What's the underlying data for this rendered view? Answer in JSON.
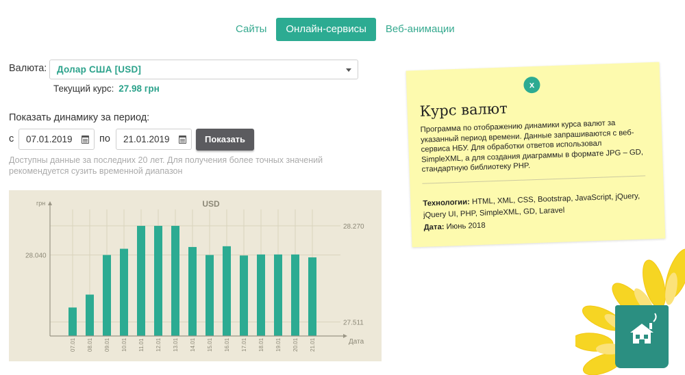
{
  "nav": {
    "tabs": [
      {
        "label": "Сайты",
        "active": false
      },
      {
        "label": "Онлайн-сервисы",
        "active": true
      },
      {
        "label": "Веб-анимации",
        "active": false
      }
    ]
  },
  "form": {
    "currency_label": "Валюта:",
    "currency_value": "Долар США [USD]",
    "rate_label": "Текущий курс:",
    "rate_value": "27.98 грн",
    "period_label": "Показать динамику за период:",
    "from_label": "с",
    "from_date": "07.01.2019",
    "to_label": "по",
    "to_date": "21.01.2019",
    "show_button": "Показать",
    "note": "Доступны данные за последних 20 лет. Для получения более точных значений рекомендуется сузить временной диапазон"
  },
  "chart_data": {
    "type": "bar",
    "title": "USD",
    "ylabel": "грн",
    "xlabel": "Дата",
    "categories": [
      "07.01",
      "08.01",
      "09.01",
      "10.01",
      "11.01",
      "12.01",
      "13.01",
      "14.01",
      "15.01",
      "16.01",
      "17.01",
      "18.01",
      "19.01",
      "20.01",
      "21.01"
    ],
    "values": [
      27.625,
      27.727,
      28.04,
      28.089,
      28.27,
      28.27,
      28.27,
      28.103,
      28.04,
      28.109,
      28.036,
      28.044,
      28.044,
      28.044,
      28.021
    ],
    "labeled_ticks": {
      "left": [
        "28.040"
      ],
      "right": [
        "28.270",
        "27.511"
      ]
    },
    "ylim": [
      27.4,
      28.4
    ],
    "bar_color": "#2cab92",
    "background": "#ede8d8",
    "grid": true
  },
  "info_card": {
    "close_label": "x",
    "title": "Курс валют",
    "description": "Программа по отображению динамики курса валют за указанный период времени. Данные запрашиваются с веб-сервиса НБУ. Для обработки ответов использовал SimpleXML, а для создания диаграммы в формате JPG – GD, стандартную библиотеку PHP.",
    "tech_label": "Технологии:",
    "tech_value": "HTML, XML, CSS, Bootstrap, JavaScript, jQuery, jQuery UI, PHP, SimpleXML, GD, Laravel",
    "date_label": "Дата:",
    "date_value": "Июнь 2018",
    "background": "#fdfaae",
    "accent": "#2cab92"
  },
  "decor": {
    "home_icon": "home-icon",
    "flower_color": "#f6d523",
    "home_bg": "#2b8f81"
  }
}
